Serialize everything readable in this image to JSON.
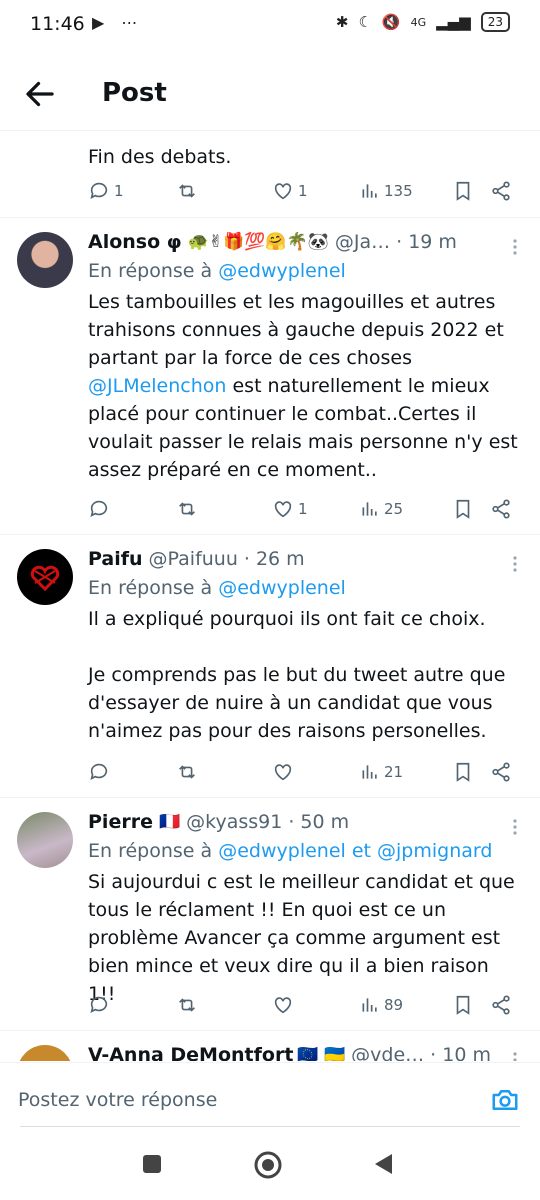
{
  "status_bar": {
    "time": "11:46",
    "left_icons": "▶ ⋯",
    "network": "4G",
    "battery": "23"
  },
  "header": {
    "title": "Post"
  },
  "tweets": [
    {
      "text": [
        "Fin des debats."
      ],
      "replies": "1",
      "retweets": "",
      "likes": "1",
      "views": "135"
    },
    {
      "name": "Alonso φ",
      "emojis": "🐢✌🎁💯🤗🌴🐼",
      "handle": "@Ja…",
      "time": "· 19 m",
      "reply_prefix": "En réponse à ",
      "reply_to": "@edwyplenel",
      "text_parts": [
        "Les tambouilles et les magouilles et autres trahisons connues à gauche depuis 2022 et partant par la force de ces choses ",
        "@JLMelenchon",
        " est naturellement le mieux placé pour continuer le combat..Certes il voulait passer le relais mais personne n'y est assez préparé en ce moment.."
      ],
      "replies": "",
      "retweets": "",
      "likes": "1",
      "views": "25"
    },
    {
      "name": "Paifu",
      "handle": "@Paifuuu",
      "time": "· 26 m",
      "reply_prefix": "En réponse à ",
      "reply_to": "@edwyplenel",
      "text": [
        "Il a expliqué pourquoi ils ont fait ce choix.",
        "Je comprends pas le but du tweet autre que d'essayer de nuire à un candidat que vous n'aimez pas pour des raisons personelles."
      ],
      "replies": "",
      "retweets": "",
      "likes": "",
      "views": "21"
    },
    {
      "name": "Pierre",
      "emojis": "🇫🇷",
      "handle": "@kyass91",
      "time": "· 50 m",
      "reply_prefix": "En réponse à ",
      "reply_to": "@edwyplenel et @jpmignard",
      "text": [
        "Si aujourdui c est le meilleur candidat et que tous le réclament !! En quoi est ce un problème  Avancer ça comme argument est bien mince et veux dire qu il a bien raison 1!!"
      ],
      "replies": "",
      "retweets": "",
      "likes": "",
      "views": "89"
    },
    {
      "name": "V-Anna DeMontfort",
      "emojis": "🇪🇺 🇺🇦",
      "handle": "@vde…",
      "time": "· 10 m"
    }
  ],
  "compose": {
    "placeholder": "Postez votre réponse",
    "camera_icon": "camera-icon"
  },
  "colors": {
    "link": "#1d9bf0",
    "muted": "#536471",
    "border": "#eff3f4"
  }
}
